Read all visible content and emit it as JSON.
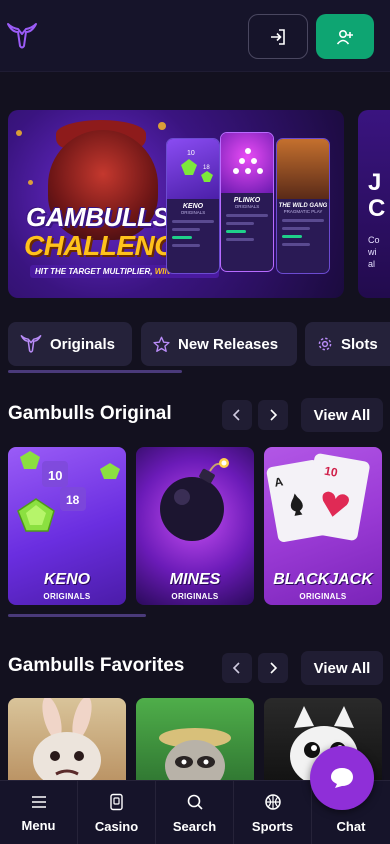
{
  "header": {
    "logo_icon": "bull-logo-icon",
    "login_icon": "sign-in-icon",
    "register_icon": "add-user-icon",
    "accent": "#0ea572"
  },
  "banner": {
    "title_line1": "GAMBULLS",
    "title_line2": "CHALLENGES",
    "subtitle_a": "HIT THE TARGET MULTIPLIER,",
    "subtitle_b": "WIN THE PRIZE",
    "cards": [
      {
        "name": "KENO",
        "sub": "ORIGINALS"
      },
      {
        "name": "PLINKO",
        "sub": "ORIGINALS"
      },
      {
        "name": "THE WILD GANG",
        "sub": "PRAGMATIC PLAY"
      }
    ],
    "next_peek_big": "J\nC",
    "next_peek_small": "Co\nwi\nal"
  },
  "tabs": [
    {
      "label": "Originals",
      "icon": "bull-icon"
    },
    {
      "label": "New Releases",
      "icon": "star-icon"
    },
    {
      "label": "Slots",
      "icon": "gear-icon"
    }
  ],
  "originals": {
    "title": "Gambulls Original",
    "view_all": "View All",
    "games": [
      {
        "name": "KENO",
        "sub": "ORIGINALS"
      },
      {
        "name": "MINES",
        "sub": "ORIGINALS"
      },
      {
        "name": "BLACKJACK",
        "sub": "ORIGINALS"
      }
    ]
  },
  "favorites": {
    "title": "Gambulls Favorites",
    "view_all": "View All"
  },
  "bottom_nav": [
    {
      "label": "Menu",
      "icon": "menu-icon"
    },
    {
      "label": "Casino",
      "icon": "casino-icon"
    },
    {
      "label": "Search",
      "icon": "search-icon"
    },
    {
      "label": "Sports",
      "icon": "basketball-icon"
    },
    {
      "label": "Chat",
      "icon": "chat-icon"
    }
  ]
}
